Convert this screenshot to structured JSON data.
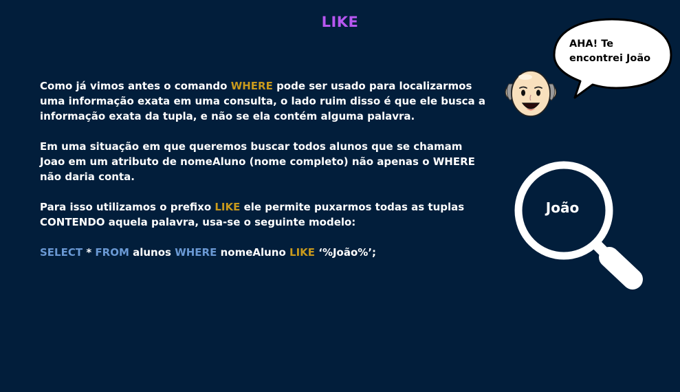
{
  "slide": {
    "title": "LIKE",
    "colors": {
      "background": "#021e3b",
      "title": "#b757f0",
      "keyword_gold": "#c99a1c",
      "keyword_blue": "#6a99d4"
    },
    "paragraph1": {
      "before": "Como já vimos antes o comando ",
      "keyword": "WHERE",
      "after": " pode ser usado para localizarmos uma informação exata em uma consulta, o lado ruim disso é que ele busca a informação exata da tupla, e não se ela contém alguma palavra."
    },
    "paragraph2": "Em uma situação em que queremos buscar todos alunos que se chamam Joao em um atributo de nomeAluno (nome completo) não apenas o WHERE não daria conta.",
    "paragraph3": {
      "before": "Para isso utilizamos o prefixo ",
      "keyword": "LIKE",
      "after": " ele permite puxarmos todas as tuplas CONTENDO aquela palavra, usa-se o seguinte modelo:"
    },
    "code": {
      "select": "SELECT",
      "star": " * ",
      "from": "FROM",
      "table": " alunos ",
      "where": "WHERE",
      "column": " nomeAluno ",
      "like": "LIKE",
      "pattern": " ‘%João%’;"
    },
    "speech_bubble": {
      "line1": "AHA! Te",
      "line2": "encontrei João"
    },
    "magnifier_label": "João",
    "icons": [
      "speech-bubble-icon",
      "bald-man-face-icon",
      "magnifying-glass-icon"
    ]
  }
}
